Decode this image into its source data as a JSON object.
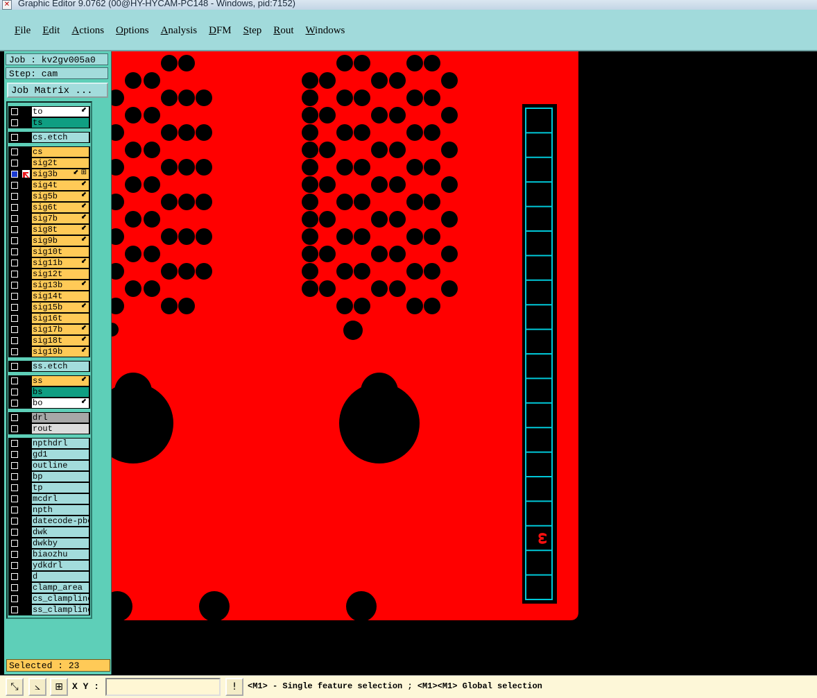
{
  "window": {
    "title": "Graphic Editor 9.0762 (00@HY-HYCAM-PC148 - Windows, pid:7152)"
  },
  "menu": [
    "File",
    "Edit",
    "Actions",
    "Options",
    "Analysis",
    "DFM",
    "Step",
    "Rout",
    "Windows"
  ],
  "job": {
    "job_label": "Job : kv2gv005a0",
    "step_label": "Step: cam",
    "matrix_button": "Job Matrix ..."
  },
  "layer_groups": [
    [
      {
        "name": "to",
        "color": "white",
        "mark": "⬋"
      },
      {
        "name": "ts",
        "color": "green",
        "mark": ""
      }
    ],
    [
      {
        "name": "cs.etch",
        "color": "cyan",
        "mark": ""
      }
    ],
    [
      {
        "name": "cs",
        "color": "orange",
        "mark": ""
      },
      {
        "name": "sig2t",
        "color": "orange",
        "mark": ""
      },
      {
        "name": "sig3b",
        "color": "orange",
        "mark": "⬋ ⊞",
        "checked": true,
        "active": true
      },
      {
        "name": "sig4t",
        "color": "orange",
        "mark": "⬋"
      },
      {
        "name": "sig5b",
        "color": "orange",
        "mark": "⬋"
      },
      {
        "name": "sig6t",
        "color": "orange",
        "mark": "⬋"
      },
      {
        "name": "sig7b",
        "color": "orange",
        "mark": "⬋"
      },
      {
        "name": "sig8t",
        "color": "orange",
        "mark": "⬋"
      },
      {
        "name": "sig9b",
        "color": "orange",
        "mark": "⬋"
      },
      {
        "name": "sig10t",
        "color": "orange",
        "mark": ""
      },
      {
        "name": "sig11b",
        "color": "orange",
        "mark": "⬋"
      },
      {
        "name": "sig12t",
        "color": "orange",
        "mark": ""
      },
      {
        "name": "sig13b",
        "color": "orange",
        "mark": "⬋"
      },
      {
        "name": "sig14t",
        "color": "orange",
        "mark": ""
      },
      {
        "name": "sig15b",
        "color": "orange",
        "mark": "⬋"
      },
      {
        "name": "sig16t",
        "color": "orange",
        "mark": ""
      },
      {
        "name": "sig17b",
        "color": "orange",
        "mark": "⬋"
      },
      {
        "name": "sig18t",
        "color": "orange",
        "mark": "⬋"
      },
      {
        "name": "sig19b",
        "color": "orange",
        "mark": "⬋"
      }
    ],
    [
      {
        "name": "ss.etch",
        "color": "cyan",
        "mark": ""
      }
    ],
    [
      {
        "name": "ss",
        "color": "orange",
        "mark": "⬋"
      },
      {
        "name": "bs",
        "color": "green",
        "mark": ""
      },
      {
        "name": "bo",
        "color": "white",
        "mark": "⬋"
      }
    ],
    [
      {
        "name": "drl",
        "color": "gray",
        "mark": ""
      },
      {
        "name": "rout",
        "color": "lgray",
        "mark": ""
      }
    ],
    [
      {
        "name": "npthdrl",
        "color": "cyan",
        "mark": ""
      },
      {
        "name": "gd1",
        "color": "cyan",
        "mark": ""
      },
      {
        "name": "outline",
        "color": "cyan",
        "mark": ""
      },
      {
        "name": "bp",
        "color": "cyan",
        "mark": ""
      },
      {
        "name": "tp",
        "color": "cyan",
        "mark": ""
      },
      {
        "name": "mcdrl",
        "color": "cyan",
        "mark": ""
      },
      {
        "name": "npth",
        "color": "cyan",
        "mark": ""
      },
      {
        "name": "datecode-pbe",
        "color": "cyan",
        "mark": ""
      },
      {
        "name": "dwk",
        "color": "cyan",
        "mark": ""
      },
      {
        "name": "dwkby",
        "color": "cyan",
        "mark": ""
      },
      {
        "name": "biaozhu",
        "color": "cyan",
        "mark": ""
      },
      {
        "name": "ydkdrl",
        "color": "cyan",
        "mark": ""
      },
      {
        "name": "d",
        "color": "cyan",
        "mark": ""
      },
      {
        "name": "clamp_area",
        "color": "cyan",
        "mark": ""
      },
      {
        "name": "cs_clampline",
        "color": "cyan",
        "mark": ""
      },
      {
        "name": "ss_clampline",
        "color": "cyan",
        "mark": ""
      }
    ]
  ],
  "selected_label": "Selected : 23",
  "canvas": {
    "copper_color": "#ff0000",
    "ladder_color": "#00c8d8",
    "ladder_marker": "ω"
  },
  "status": {
    "xy_label": "X Y :",
    "xy_value": "",
    "hint": "<M1> - Single feature selection ; <M1><M1> Global selection"
  }
}
